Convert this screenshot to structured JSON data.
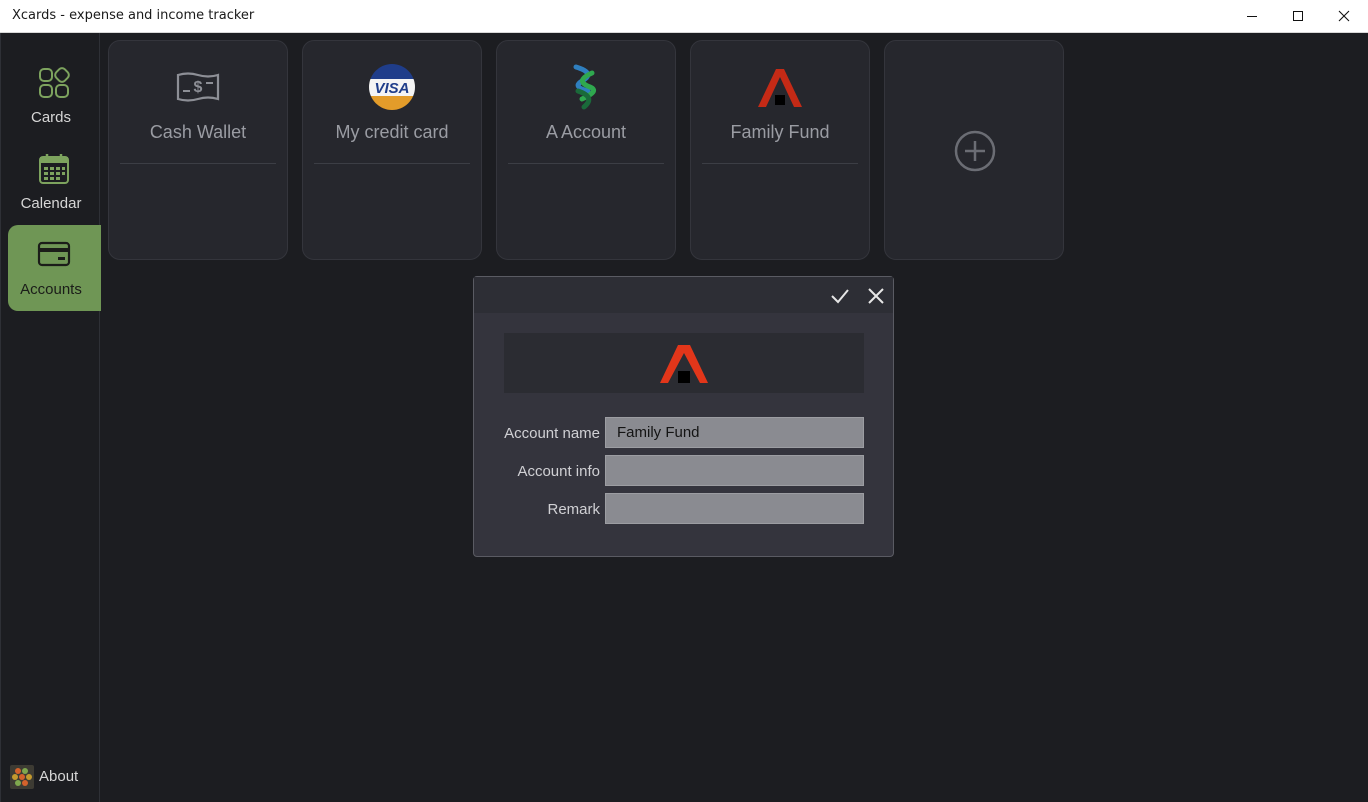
{
  "window": {
    "title": "Xcards - expense and income tracker",
    "controls": [
      "minimize-icon",
      "maximize-icon",
      "close-icon"
    ]
  },
  "sidebar": {
    "items": [
      {
        "label": "Cards",
        "icon": "cards-grid-icon",
        "active": false
      },
      {
        "label": "Calendar",
        "icon": "calendar-icon",
        "active": false
      },
      {
        "label": "Accounts",
        "icon": "credit-card-icon",
        "active": true
      }
    ],
    "about": {
      "label": "About",
      "icon": "hexagon-logo-icon"
    }
  },
  "accounts": [
    {
      "name": "Cash Wallet",
      "icon": "cash-icon"
    },
    {
      "name": "My credit card",
      "icon": "visa-icon"
    },
    {
      "name": "A Account",
      "icon": "bank-logo-icon"
    },
    {
      "name": "Family Fund",
      "icon": "house-logo-icon"
    }
  ],
  "add_account": {
    "icon": "plus-circle-icon"
  },
  "dialog": {
    "confirm_icon": "check-icon",
    "close_icon": "close-icon",
    "selected_icon": "house-logo-icon",
    "fields": {
      "account_name": {
        "label": "Account name",
        "value": "Family Fund"
      },
      "account_info": {
        "label": "Account info",
        "value": ""
      },
      "remark": {
        "label": "Remark",
        "value": ""
      }
    }
  },
  "colors": {
    "accent": "#6f9655",
    "background": "#1c1d21",
    "card": "#26272d",
    "logo_red": "#e2361a"
  }
}
